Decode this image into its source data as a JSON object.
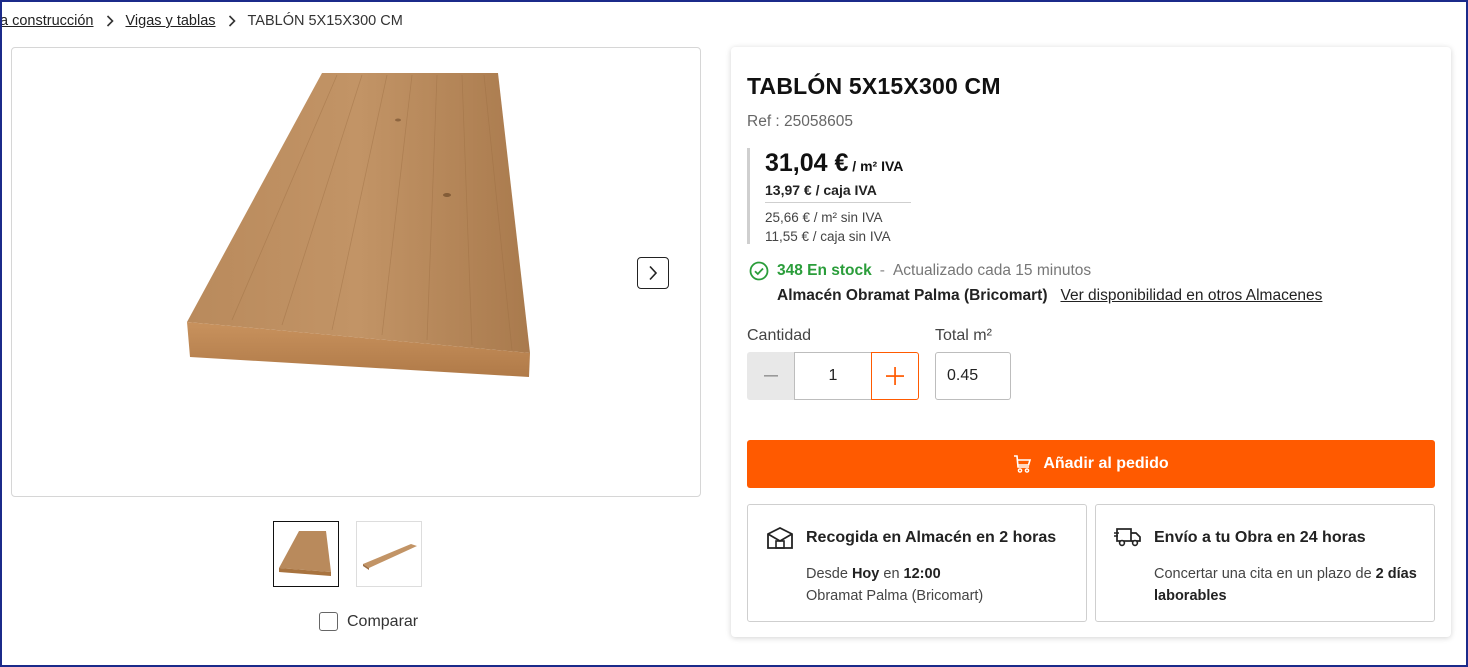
{
  "breadcrumb": {
    "items": [
      "a construcción",
      "Vigas y tablas"
    ],
    "current": "TABLÓN 5X15X300 CM"
  },
  "gallery": {
    "main_image": "wooden-plank-photo",
    "thumbnails": [
      "wooden-plank-thumbnail",
      "wooden-plank-angle-thumbnail"
    ],
    "selected_thumbnail": 0,
    "compare_label": "Comparar",
    "compare_checked": false
  },
  "product": {
    "title": "TABLÓN 5X15X300 CM",
    "ref": "Ref : 25058605"
  },
  "price": {
    "main": "31,04 €",
    "main_unit": " / m² IVA",
    "box": "13,97 € / caja IVA",
    "sub_m2": "25,66 € / m² sin IVA",
    "sub_box": "11,55 € / caja sin IVA"
  },
  "stock": {
    "count": "348 En stock",
    "separator": "-",
    "updated": "Actualizado cada 15 minutos",
    "warehouse": "Almacén Obramat Palma (Bricomart)",
    "availability_link": "Ver disponibilidad en otros Almacenes"
  },
  "quantity": {
    "label": "Cantidad",
    "value": "1",
    "total_label": "Total m²",
    "total_value": "0.45"
  },
  "actions": {
    "add_label": "Añadir al pedido"
  },
  "delivery": {
    "pickup": {
      "title": "Recogida en Almacén en 2 horas",
      "line1_pre": "Desde ",
      "line1_day": "Hoy",
      "line1_mid": " en ",
      "line1_time": "12:00",
      "line2": "Obramat Palma (Bricomart)"
    },
    "shipping": {
      "title": "Envío a tu Obra en 24 horas",
      "text_pre": "Concertar una cita en un plazo de ",
      "text_bold": "2 días laborables"
    }
  },
  "colors": {
    "accent": "#ff5a00",
    "stock_green": "#2a9d3a",
    "frame": "#1b2a8a"
  }
}
